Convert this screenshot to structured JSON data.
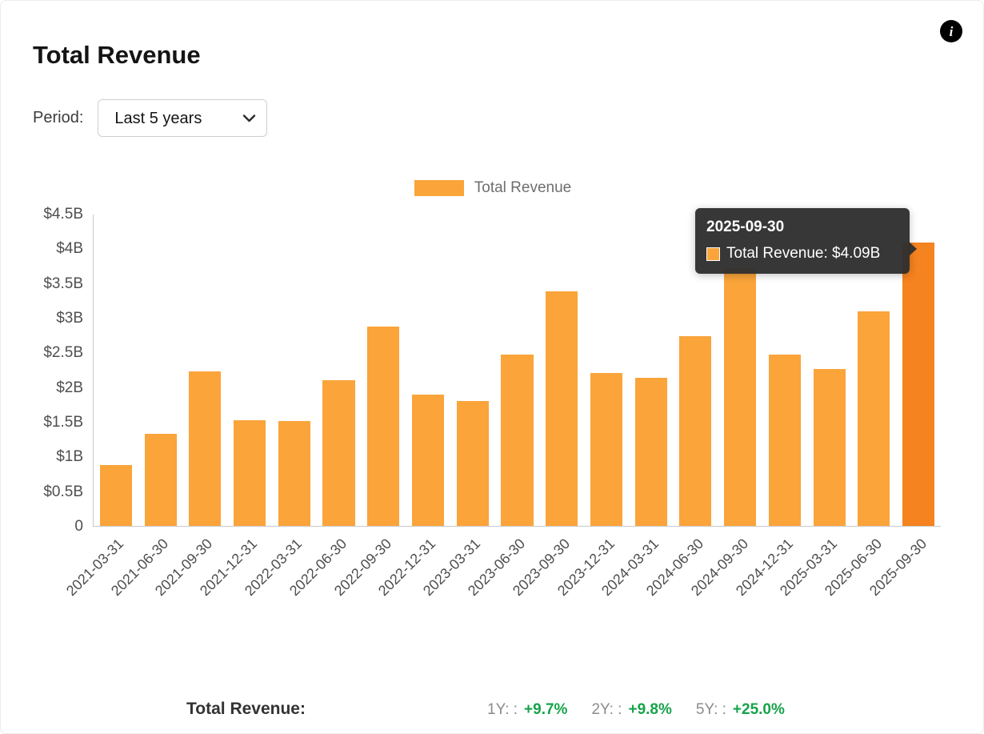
{
  "card": {
    "title": "Total Revenue",
    "info_icon": "i"
  },
  "period": {
    "label": "Period:",
    "selected": "Last 5 years",
    "options": [
      "Last 5 years"
    ]
  },
  "legend": {
    "label": "Total Revenue",
    "color": "#FAA43A"
  },
  "chart_data": {
    "type": "bar",
    "title": "Total Revenue",
    "series_name": "Total Revenue",
    "categories": [
      "2021-03-31",
      "2021-06-30",
      "2021-09-30",
      "2021-12-31",
      "2022-03-31",
      "2022-06-30",
      "2022-09-30",
      "2022-12-31",
      "2023-03-31",
      "2023-06-30",
      "2023-09-30",
      "2023-12-31",
      "2024-03-31",
      "2024-06-30",
      "2024-09-30",
      "2024-12-31",
      "2025-03-31",
      "2025-06-30",
      "2025-09-30"
    ],
    "values": [
      0.88,
      1.33,
      2.23,
      1.53,
      1.51,
      2.1,
      2.88,
      1.9,
      1.81,
      2.48,
      3.39,
      2.21,
      2.14,
      2.74,
      3.73,
      2.48,
      2.27,
      3.1,
      4.09
    ],
    "unit": "$B",
    "xlabel": "",
    "ylabel": "",
    "ylim": [
      0,
      4.5
    ],
    "y_ticks": [
      {
        "value": 0,
        "label": "0"
      },
      {
        "value": 0.5,
        "label": "$0.5B"
      },
      {
        "value": 1,
        "label": "$1B"
      },
      {
        "value": 1.5,
        "label": "$1.5B"
      },
      {
        "value": 2,
        "label": "$2B"
      },
      {
        "value": 2.5,
        "label": "$2.5B"
      },
      {
        "value": 3,
        "label": "$3B"
      },
      {
        "value": 3.5,
        "label": "$3.5B"
      },
      {
        "value": 4,
        "label": "$4B"
      },
      {
        "value": 4.5,
        "label": "$4.5B"
      }
    ],
    "bar_color": "#FAA43A",
    "highlight_color": "#F5831F",
    "highlighted_index": 18,
    "grid": false,
    "legend_position": "top-center"
  },
  "tooltip": {
    "date": "2025-09-30",
    "label": "Total Revenue",
    "value": "$4.09B",
    "text": "Total Revenue: $4.09B"
  },
  "footer": {
    "label": "Total Revenue:",
    "positive_color": "#16a34a",
    "stats": [
      {
        "label": "1Y: :",
        "value": "+9.7%"
      },
      {
        "label": "2Y: :",
        "value": "+9.8%"
      },
      {
        "label": "5Y: :",
        "value": "+25.0%"
      }
    ]
  }
}
